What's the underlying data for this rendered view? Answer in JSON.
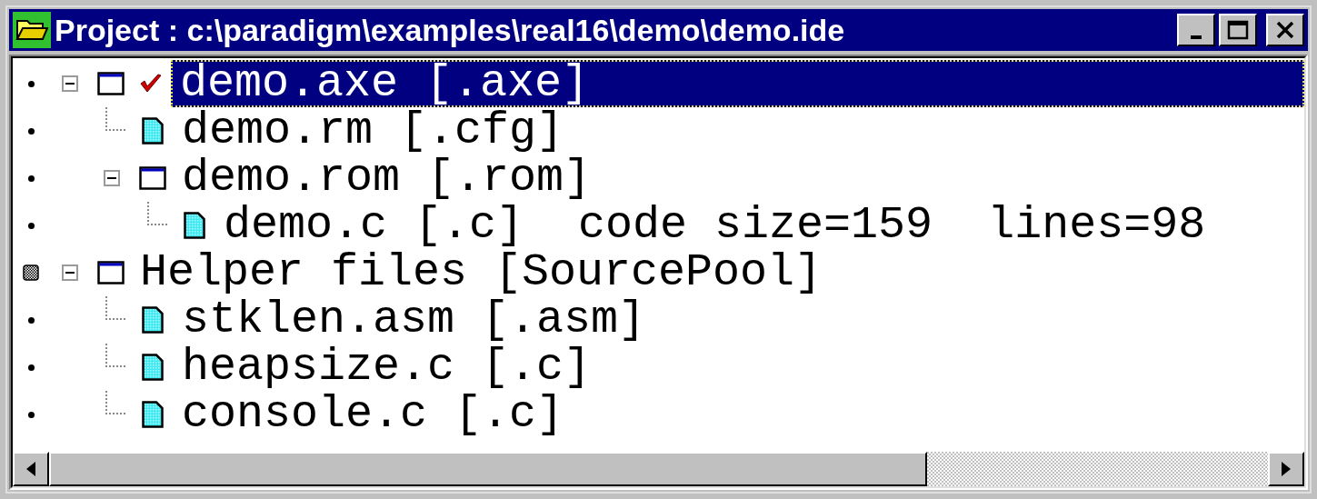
{
  "window": {
    "title": "Project : c:\\paradigm\\examples\\real16\\demo\\demo.ide"
  },
  "tree": [
    {
      "label": "demo.axe [.axe]",
      "kind": "target",
      "marked": false,
      "checked": true,
      "selected": true,
      "expanded": true,
      "children": [
        {
          "label": "demo.rm [.cfg]",
          "kind": "file",
          "marked": false,
          "selected": false
        },
        {
          "label": "demo.rom [.rom]",
          "kind": "target",
          "marked": false,
          "checked": false,
          "selected": false,
          "expanded": true,
          "children": [
            {
              "label": "demo.c [.c]  code size=159  lines=98",
              "kind": "file",
              "marked": false,
              "selected": false
            }
          ]
        }
      ]
    },
    {
      "label": "Helper files [SourcePool]",
      "kind": "target",
      "marked": true,
      "checked": false,
      "selected": false,
      "expanded": true,
      "children": [
        {
          "label": "stklen.asm [.asm]",
          "kind": "file",
          "marked": false,
          "selected": false
        },
        {
          "label": "heapsize.c [.c]",
          "kind": "file",
          "marked": false,
          "selected": false
        },
        {
          "label": "console.c [.c]",
          "kind": "file",
          "marked": false,
          "selected": false
        }
      ]
    }
  ],
  "scrollbar": {
    "level": 0.72
  }
}
